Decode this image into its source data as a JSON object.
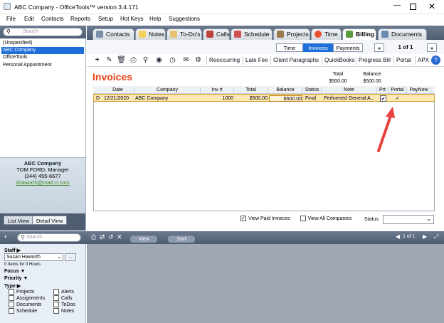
{
  "window": {
    "title": "ABC Company - OfficeTools™ version 3.4.171"
  },
  "menu": [
    "File",
    "Edit",
    "Contacts",
    "Reports",
    "Setup",
    "Hot Keys",
    "Help",
    "Suggestions"
  ],
  "search": {
    "placeholder": "Search"
  },
  "contacts": [
    "(Unspecified)",
    "ABC Company",
    "OfficeTools",
    "Personal Appointment"
  ],
  "card": {
    "name": "ABC Company",
    "person": "TOM FORD, Manager",
    "phone": "(244) 455-6677",
    "email": "shaworth@triad.rr.com"
  },
  "views": {
    "list": "List View",
    "detail": "Detail View"
  },
  "tabs": [
    "Contacts",
    "Notes",
    "To-Do's",
    "Calls",
    "Schedule",
    "Projects",
    "Time",
    "Billing",
    "Documents"
  ],
  "subtabs": {
    "time": "Time",
    "invoices": "Invoices",
    "payments": "Payments",
    "page": "1 of 1",
    "first": "«",
    "last": "»"
  },
  "toolbar": [
    "Reoccurring",
    "Late Fee",
    "Client Paragraphs",
    "QuickBooks",
    "Progress Bill",
    "Portal",
    "APX"
  ],
  "invoices": {
    "heading": "Invoices",
    "total_label": "Total",
    "total_value": "$500.00",
    "balance_label": "Balance",
    "balance_value": "$500.00"
  },
  "columns": [
    "Date",
    "Company",
    "Inv #",
    "Total",
    "Balance",
    "Status",
    "Note",
    "Prt",
    "Portal",
    "PayNow"
  ],
  "row": {
    "flag": "D",
    "date": "12/21/2020",
    "company": "ABC Company",
    "inv": "1000",
    "total": "$500.00",
    "balance": "$500.00",
    "status": "Final",
    "note": "Performed General A...",
    "prt": "✔",
    "portal": "✓"
  },
  "options": {
    "paid": "View Paid Invoices",
    "all": "View All Companies",
    "status": "Status"
  },
  "bottom": {
    "search_placeholder": "Search",
    "view": "View",
    "sort": "Sort",
    "page": "1 of 1"
  },
  "filters": {
    "staff_label": "Staff ▶",
    "staff_value": "Susan Haworth",
    "items": "0 Items for 0 Hours",
    "focus": "Focus ▼",
    "priority": "Priority ▼",
    "type": "Type ▶",
    "types_left": [
      "Projects",
      "Assignments",
      "Documents",
      "Schedule"
    ],
    "types_right": [
      "Alerts",
      "Calls",
      "ToDos",
      "Notes"
    ]
  },
  "colors": {
    "accent": "#1e6fd9",
    "heading": "#e84118",
    "arrow": "#e8413e",
    "selected_row": "#fde8b5"
  }
}
